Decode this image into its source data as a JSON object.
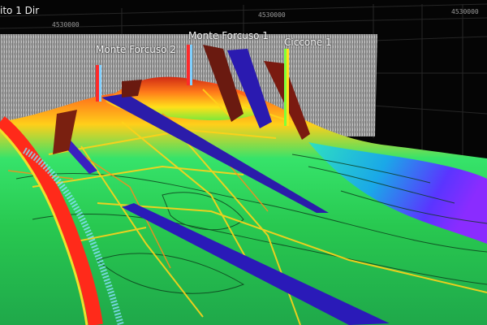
{
  "view": {
    "title_fragment": "ito 1 Dir",
    "axis_ticks": [
      "4530000",
      "4530000",
      "4530000"
    ]
  },
  "wells": [
    {
      "name": "Monte Forcuso 2",
      "color": "#ff2a2a"
    },
    {
      "name": "Monte Forcuso 1",
      "color": "#ff3b3b"
    },
    {
      "name": "Ciccone 1",
      "color": "#7fff3a"
    }
  ],
  "colors": {
    "background": "#050505",
    "grid": "#2a2a2a",
    "surface_high": "#ff4a1a",
    "surface_mid": "#2ecc40",
    "surface_low": "#6a2cff",
    "fault_red": "#7a1a10",
    "fault_blue": "#2a1aa8",
    "fault_lines": "#ffd21a"
  }
}
